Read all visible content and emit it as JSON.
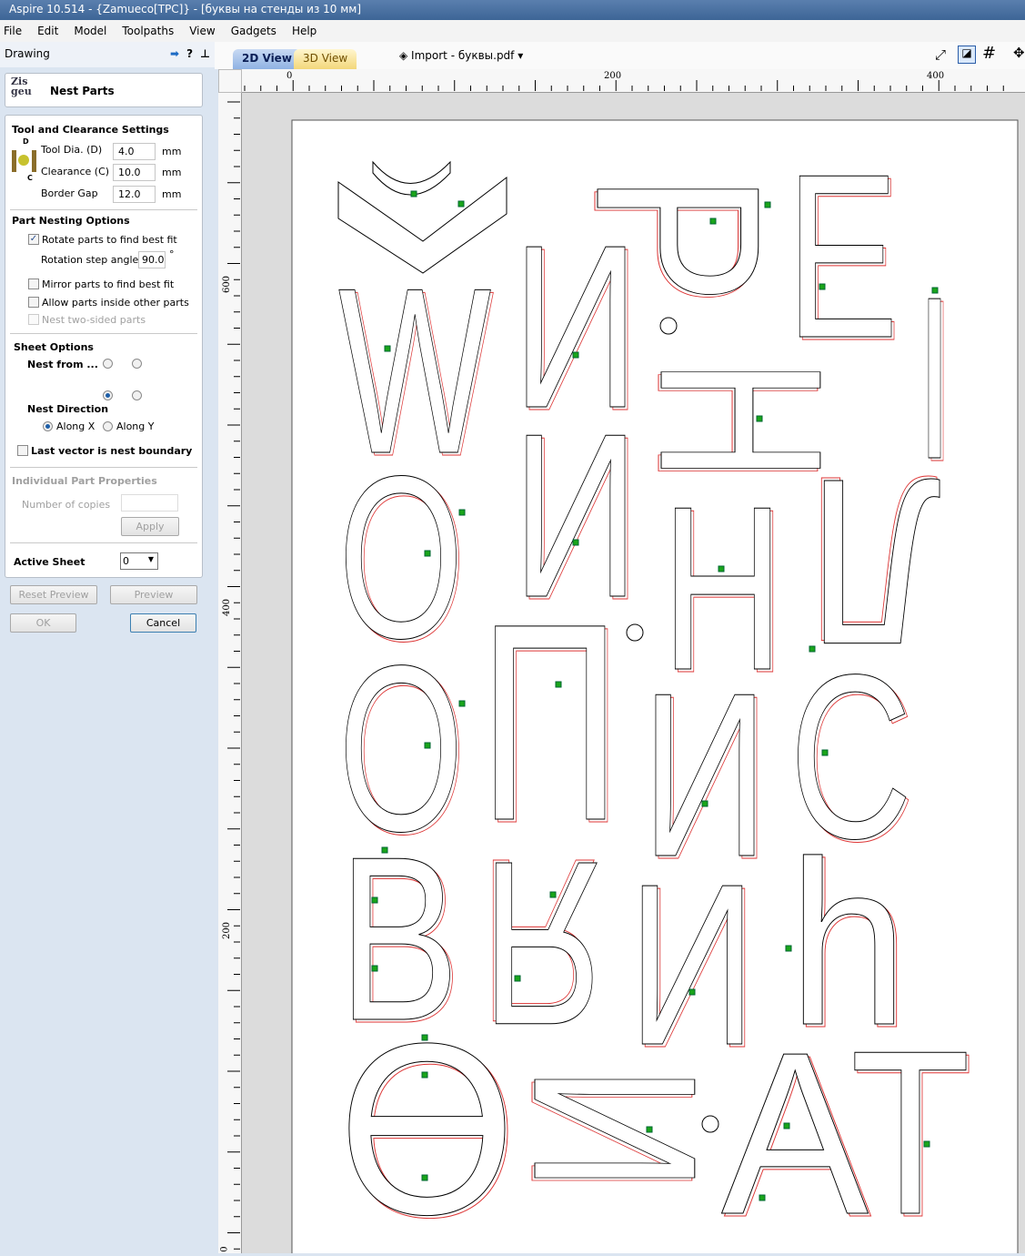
{
  "window": {
    "title": "Aspire 10.514 - {Zamueco[TPC]} - [буквы на стенды из 10 мм]"
  },
  "menu": [
    "File",
    "Edit",
    "Model",
    "Toolpaths",
    "View",
    "Gadgets",
    "Help"
  ],
  "panel": {
    "title": "Drawing",
    "tool_name": "Nest Parts",
    "tool": {
      "heading": "Tool and Clearance Settings",
      "d": "D",
      "c": "C",
      "tool_dia_label": "Tool Dia. (D)",
      "tool_dia": "4.0",
      "clearance_label": "Clearance (C)",
      "clearance": "10.0",
      "border_label": "Border Gap",
      "border": "12.0",
      "unit": "mm"
    },
    "nesting": {
      "heading": "Part Nesting Options",
      "rotate": "Rotate parts to find best fit",
      "rotate_checked": true,
      "step_label": "Rotation step angle",
      "step": "90.0",
      "deg": "°",
      "mirror": "Mirror parts to find best fit",
      "inside": "Allow parts inside other parts",
      "two_sided": "Nest two-sided parts"
    },
    "sheet": {
      "heading": "Sheet Options",
      "nest_from": "Nest from ...",
      "nest_from_selected": "bottom-left",
      "direction": "Nest Direction",
      "along_x": "Along X",
      "along_y": "Along Y",
      "last_vector": "Last vector is nest boundary"
    },
    "part": {
      "heading": "Individual Part Properties",
      "copies": "Number of copies",
      "apply": "Apply"
    },
    "active_sheet_label": "Active Sheet",
    "active_sheet": "0",
    "buttons": {
      "reset": "Reset Preview",
      "preview": "Preview",
      "ok": "OK",
      "cancel": "Cancel"
    }
  },
  "view": {
    "tab_2d": "2D View",
    "tab_3d": "3D View",
    "import": "Import - буквы.pdf",
    "ruler_top": [
      "0",
      "200",
      "400"
    ],
    "ruler_left": [
      "600",
      "400",
      "200",
      "0"
    ]
  },
  "canvas": {
    "parts": [
      "W",
      "И",
      "Р",
      "Е",
      "I",
      "Н",
      "О",
      "И",
      "Н",
      "Л",
      "О",
      "П",
      "И",
      "С",
      "В",
      "Я",
      "И",
      "h",
      "Ө",
      "И",
      "А",
      "Т"
    ]
  }
}
